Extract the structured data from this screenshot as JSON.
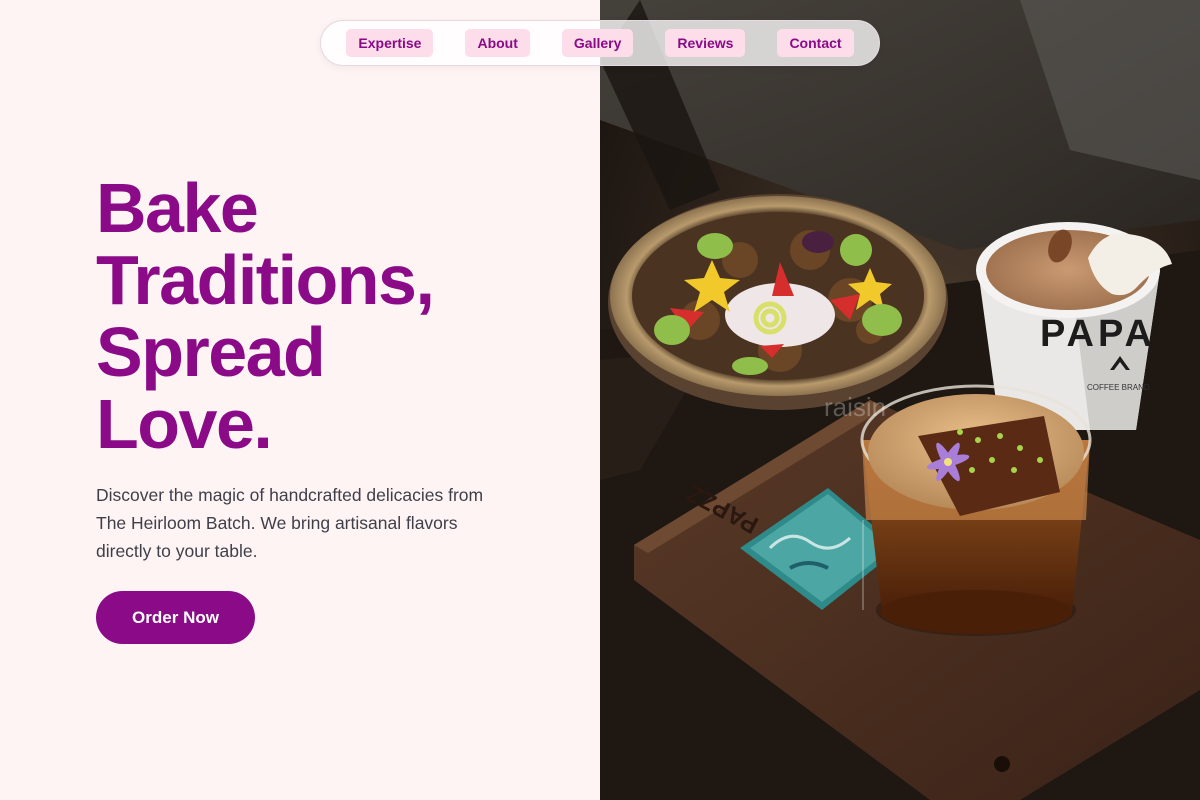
{
  "nav": {
    "links": [
      {
        "label": "Expertise"
      },
      {
        "label": "About"
      },
      {
        "label": "Gallery"
      },
      {
        "label": "Reviews"
      },
      {
        "label": "Contact"
      }
    ]
  },
  "hero": {
    "headline_lines": [
      "Bake",
      "Traditions,",
      "Spread",
      "Love."
    ],
    "description": "Discover the magic of handcrafted delicacies from The Heirloom Batch. We bring artisanal flavors directly to your table.",
    "cta_label": "Order Now"
  },
  "photo": {
    "cup_print": "PAPA",
    "cup_subprint": "COFFEE BRAND",
    "tray_engraving": "PAPZZ",
    "watermark": "raisin"
  },
  "colors": {
    "brand": "#8a0a87",
    "background": "#fff4f4",
    "nav_pill": "#fcdde9",
    "body_text": "#3f3f4a"
  }
}
